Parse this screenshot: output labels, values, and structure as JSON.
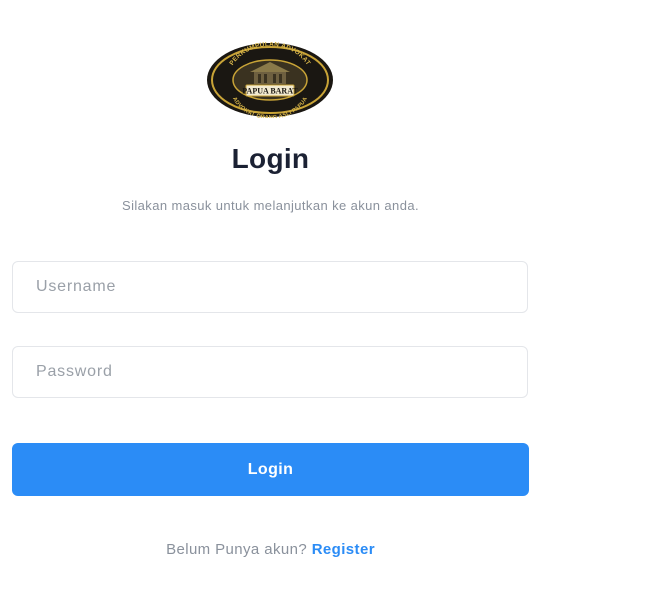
{
  "logo": {
    "top_text": "PERKUMPULAN ADVOKAT",
    "banner_text": "PAPUA BARAT",
    "bottom_text": "ADVOKAT ORANG ASLI PAPUA",
    "colors": {
      "ring": "#1a1712",
      "gold": "#c9a437",
      "center": "#3a3220"
    }
  },
  "header": {
    "title": "Login",
    "subtitle": "Silakan masuk untuk melanjutkan ke akun anda."
  },
  "form": {
    "username_placeholder": "Username",
    "username_value": "",
    "password_placeholder": "Password",
    "password_value": "",
    "submit_label": "Login"
  },
  "footer": {
    "prompt": "Belum Punya akun?",
    "register_label": "Register"
  },
  "colors": {
    "accent": "#2b8cf6",
    "title": "#1b2133",
    "muted": "#8a919c",
    "border": "#e4e6ea"
  }
}
